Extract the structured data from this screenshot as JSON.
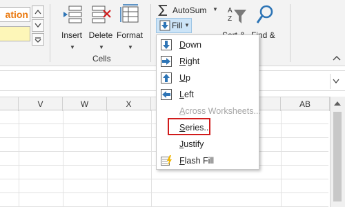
{
  "styles": {
    "top_label": "ation",
    "accent_color": "#ea7a12"
  },
  "cells_group": {
    "label": "Cells",
    "insert_label": "Insert",
    "delete_label": "Delete",
    "format_label": "Format"
  },
  "editing": {
    "autosum_label": "AutoSum",
    "fill_label": "Fill",
    "sort_label": "Sort &",
    "find_label": "Find &"
  },
  "columns": [
    "V",
    "W",
    "X",
    "AB"
  ],
  "fill_menu": {
    "items": [
      {
        "label": "Down",
        "icon": "fill-down-icon",
        "disabled": false
      },
      {
        "label": "Right",
        "icon": "fill-right-icon",
        "disabled": false
      },
      {
        "label": "Up",
        "icon": "fill-up-icon",
        "disabled": false
      },
      {
        "label": "Left",
        "icon": "fill-left-icon",
        "disabled": false
      },
      {
        "label": "Across Worksheets...",
        "icon": "",
        "disabled": true
      },
      {
        "label": "Series...",
        "icon": "",
        "disabled": false
      },
      {
        "label": "Justify",
        "icon": "",
        "disabled": false
      },
      {
        "label": "Flash Fill",
        "icon": "flash-fill-icon",
        "disabled": false
      }
    ]
  }
}
